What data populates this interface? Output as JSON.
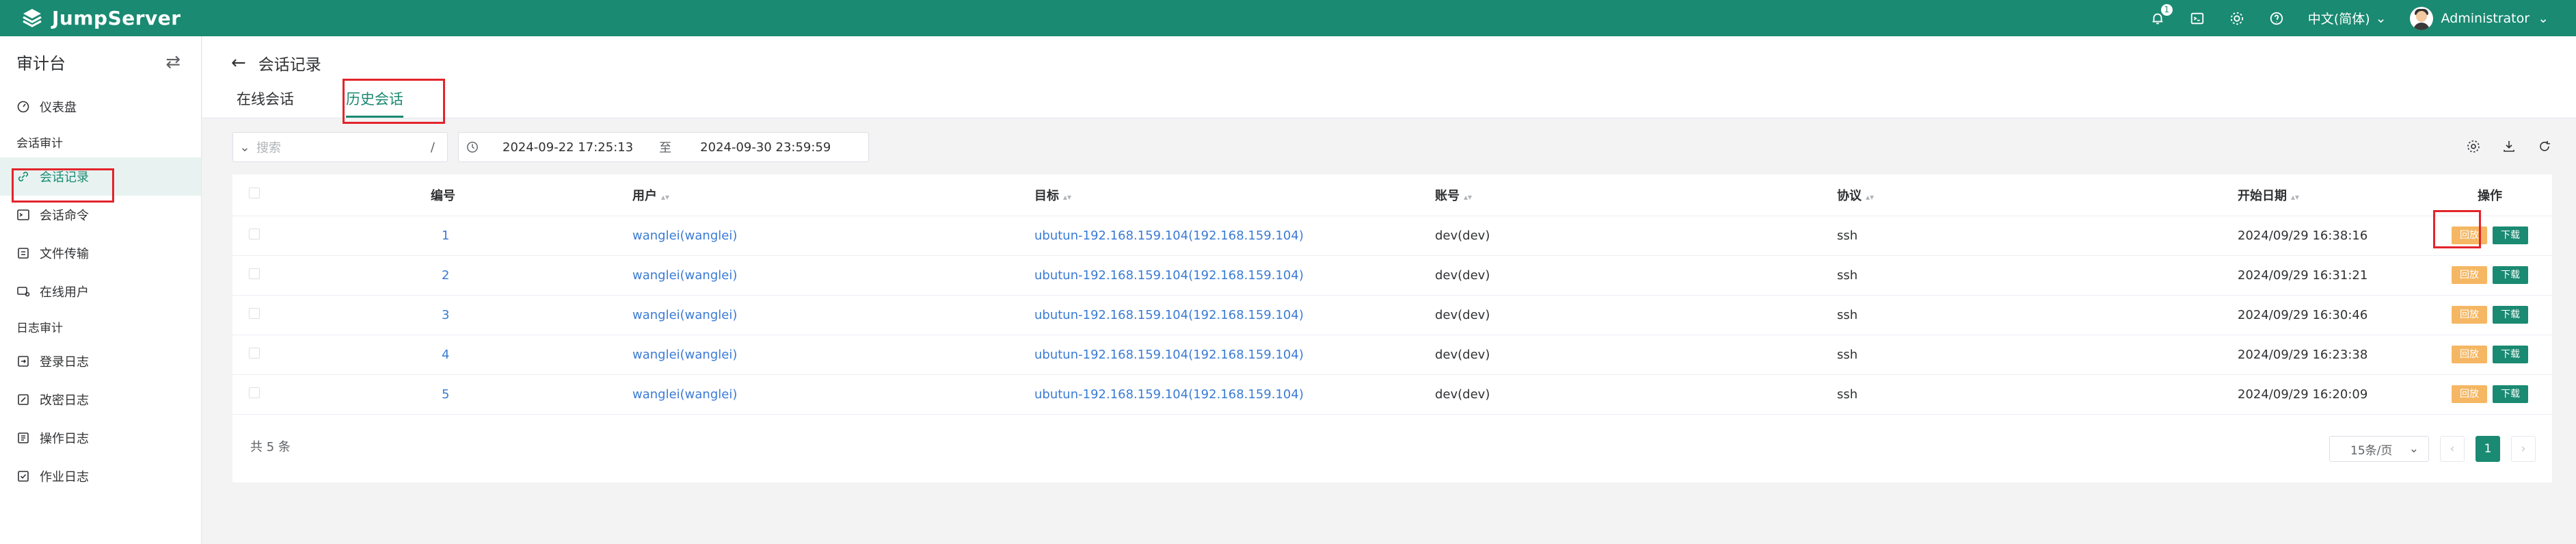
{
  "app": {
    "name": "JumpServer"
  },
  "header": {
    "notification_count": "1",
    "language": "中文(简体)",
    "user_name": "Administrator"
  },
  "sidebar": {
    "title": "审计台",
    "items": [
      {
        "label": "仪表盘",
        "icon": "dashboard-icon"
      },
      {
        "group": "会话审计"
      },
      {
        "label": "会话记录",
        "icon": "link-icon",
        "active": true
      },
      {
        "label": "会话命令",
        "icon": "terminal-icon"
      },
      {
        "label": "文件传输",
        "icon": "file-transfer-icon"
      },
      {
        "label": "在线用户",
        "icon": "online-user-icon"
      },
      {
        "group": "日志审计"
      },
      {
        "label": "登录日志",
        "icon": "login-log-icon"
      },
      {
        "label": "改密日志",
        "icon": "password-log-icon"
      },
      {
        "label": "操作日志",
        "icon": "operate-log-icon"
      },
      {
        "label": "作业日志",
        "icon": "job-log-icon"
      }
    ]
  },
  "page": {
    "title": "会话记录",
    "tabs": [
      "在线会话",
      "历史会话"
    ],
    "active_tab": "历史会话"
  },
  "filter": {
    "search_placeholder": "搜索",
    "search_shortcut": "/",
    "date_from": "2024-09-22 17:25:13",
    "date_sep": "至",
    "date_to": "2024-09-30 23:59:59"
  },
  "table": {
    "columns": [
      "编号",
      "用户",
      "目标",
      "账号",
      "协议",
      "开始日期",
      "操作"
    ],
    "rows": [
      {
        "id": "1",
        "user": "wanglei(wanglei)",
        "target": "ubutun-192.168.159.104(192.168.159.104)",
        "account": "dev(dev)",
        "protocol": "ssh",
        "start": "2024/09/29 16:38:16"
      },
      {
        "id": "2",
        "user": "wanglei(wanglei)",
        "target": "ubutun-192.168.159.104(192.168.159.104)",
        "account": "dev(dev)",
        "protocol": "ssh",
        "start": "2024/09/29 16:31:21"
      },
      {
        "id": "3",
        "user": "wanglei(wanglei)",
        "target": "ubutun-192.168.159.104(192.168.159.104)",
        "account": "dev(dev)",
        "protocol": "ssh",
        "start": "2024/09/29 16:30:46"
      },
      {
        "id": "4",
        "user": "wanglei(wanglei)",
        "target": "ubutun-192.168.159.104(192.168.159.104)",
        "account": "dev(dev)",
        "protocol": "ssh",
        "start": "2024/09/29 16:23:38"
      },
      {
        "id": "5",
        "user": "wanglei(wanglei)",
        "target": "ubutun-192.168.159.104(192.168.159.104)",
        "account": "dev(dev)",
        "protocol": "ssh",
        "start": "2024/09/29 16:20:09"
      }
    ],
    "replay_label": "回放",
    "download_label": "下载"
  },
  "footer": {
    "total": "共 5 条",
    "page_size": "15条/页",
    "current_page": "1"
  },
  "colors": {
    "brand": "#1a8a72",
    "replay": "#f5b763",
    "link": "#3a7bd5",
    "annotation": "#e3242b"
  }
}
